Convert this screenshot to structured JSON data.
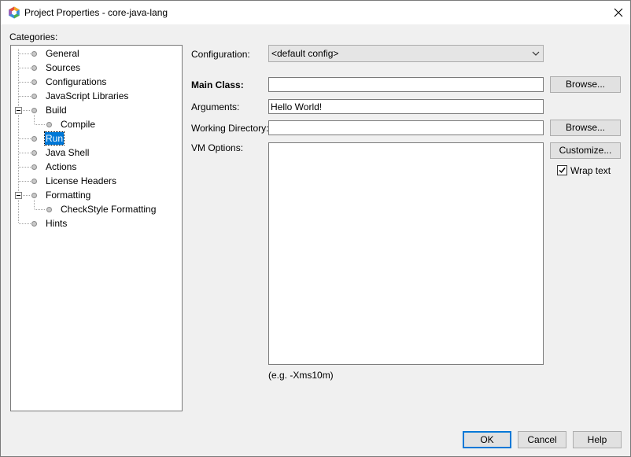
{
  "window": {
    "title": "Project Properties - core-java-lang"
  },
  "categories": {
    "label": "Categories:",
    "items": [
      {
        "label": "General"
      },
      {
        "label": "Sources"
      },
      {
        "label": "Configurations"
      },
      {
        "label": "JavaScript Libraries"
      },
      {
        "label": "Build"
      },
      {
        "label": "Compile"
      },
      {
        "label": "Run"
      },
      {
        "label": "Java Shell"
      },
      {
        "label": "Actions"
      },
      {
        "label": "License Headers"
      },
      {
        "label": "Formatting"
      },
      {
        "label": "CheckStyle Formatting"
      },
      {
        "label": "Hints"
      }
    ],
    "selected": "Run"
  },
  "form": {
    "configuration_label": "Configuration:",
    "configuration_value": "<default config>",
    "main_class_label": "Main Class:",
    "main_class_value": "",
    "arguments_label": "Arguments:",
    "arguments_value": "Hello World!",
    "working_directory_label": "Working Directory:",
    "working_directory_value": "",
    "vm_options_label": "VM Options:",
    "vm_options_hint": "(e.g. -Xms10m)",
    "browse_label": "Browse...",
    "customize_label": "Customize...",
    "wrap_text_label": "Wrap text",
    "wrap_text_checked": true
  },
  "footer": {
    "ok_label": "OK",
    "cancel_label": "Cancel",
    "help_label": "Help"
  },
  "colors": {
    "selection": "#0078d7",
    "button_face": "#e1e1e1",
    "dialog_bg": "#f0f0f0"
  }
}
